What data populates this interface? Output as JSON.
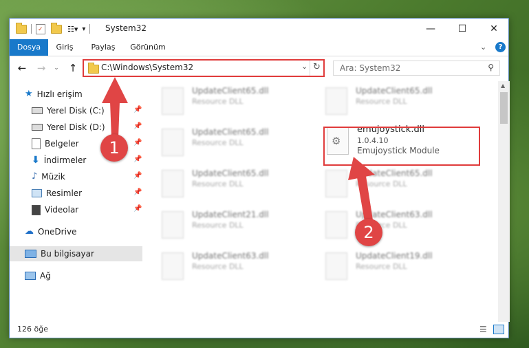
{
  "window": {
    "title": "System32"
  },
  "ribbon": {
    "tabs": [
      "Dosya",
      "Giriş",
      "Paylaş",
      "Görünüm"
    ]
  },
  "address": {
    "path": "C:\\Windows\\System32"
  },
  "search": {
    "placeholder": "Ara: System32"
  },
  "nav": {
    "quick_access": "Hızlı erişim",
    "items": [
      "Yerel Disk (C:)",
      "Yerel Disk (D:)",
      "Belgeler",
      "İndirmeler",
      "Müzik",
      "Resimler",
      "Videolar"
    ],
    "onedrive": "OneDrive",
    "this_pc": "Bu bilgisayar",
    "network": "Ağ"
  },
  "files": [
    {
      "name": "UpdateClient65.dll",
      "desc": "Resource DLL"
    },
    {
      "name": "UpdateClient65.dll",
      "desc": "Resource DLL"
    },
    {
      "name": "UpdateClient65.dll",
      "desc": "Resource DLL"
    },
    {
      "name": "emujoystick.dll",
      "version": "1.0.4.10",
      "desc": "Emujoystick Module"
    },
    {
      "name": "UpdateClient65.dll",
      "desc": "Resource DLL"
    },
    {
      "name": "UpdateClient65.dll",
      "desc": "Resource DLL"
    },
    {
      "name": "UpdateClient21.dll",
      "desc": "Resource DLL"
    },
    {
      "name": "UpdateClient63.dll",
      "desc": "Resource DLL"
    },
    {
      "name": "UpdateClient63.dll",
      "desc": "Resource DLL"
    },
    {
      "name": "UpdateClient19.dll",
      "desc": "Resource DLL"
    }
  ],
  "callouts": [
    "1",
    "2"
  ],
  "status": {
    "count": "126 öğe"
  },
  "icons": {
    "quick_access": "star-icon",
    "drive": "drive-icon",
    "documents": "documents-icon",
    "downloads": "download-arrow-icon",
    "music": "music-icon",
    "pictures": "pictures-icon",
    "videos": "videos-icon",
    "onedrive": "cloud-icon",
    "this_pc": "monitor-icon",
    "network": "network-icon"
  },
  "colors": {
    "accent": "#1979ca",
    "highlight": "#e03b3b",
    "callout": "#e04545"
  }
}
